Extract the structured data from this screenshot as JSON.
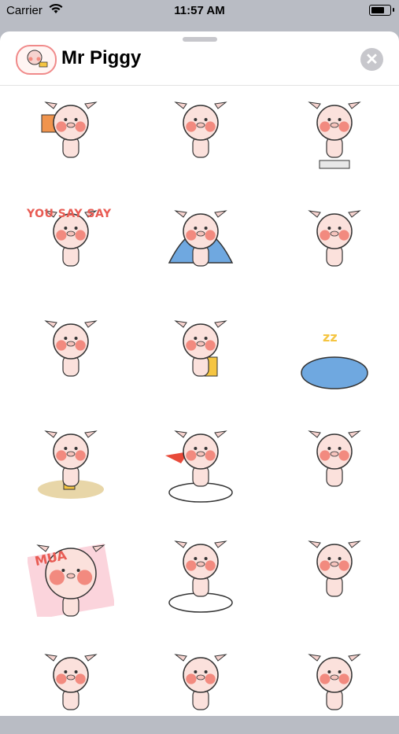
{
  "status_bar": {
    "carrier": "Carrier",
    "time": "11:57 AM"
  },
  "sheet": {
    "title": "Mr Piggy",
    "close_icon": "✕"
  },
  "stickers": [
    {
      "name": "sticker-piggy-holding-sign"
    },
    {
      "name": "sticker-piggy-lying-with-cup"
    },
    {
      "name": "sticker-piggy-on-scale"
    },
    {
      "name": "sticker-you-say-say",
      "caption": "YOU SAY SAY"
    },
    {
      "name": "sticker-piggy-under-blanket"
    },
    {
      "name": "sticker-piggy-standing"
    },
    {
      "name": "sticker-piggy-in-bed-with-phone"
    },
    {
      "name": "sticker-piggy-on-chair"
    },
    {
      "name": "sticker-blue-blanket-sleeping"
    },
    {
      "name": "sticker-piggy-drinking"
    },
    {
      "name": "sticker-piggy-hero-cloud"
    },
    {
      "name": "sticker-piggy-eating"
    },
    {
      "name": "sticker-piggy-mua-kiss",
      "caption": "MUA"
    },
    {
      "name": "sticker-piggy-on-pillow"
    },
    {
      "name": "sticker-piggy-running"
    },
    {
      "name": "sticker-piggy-hanging"
    },
    {
      "name": "sticker-piggy-peeking"
    },
    {
      "name": "sticker-piggy-face"
    }
  ]
}
